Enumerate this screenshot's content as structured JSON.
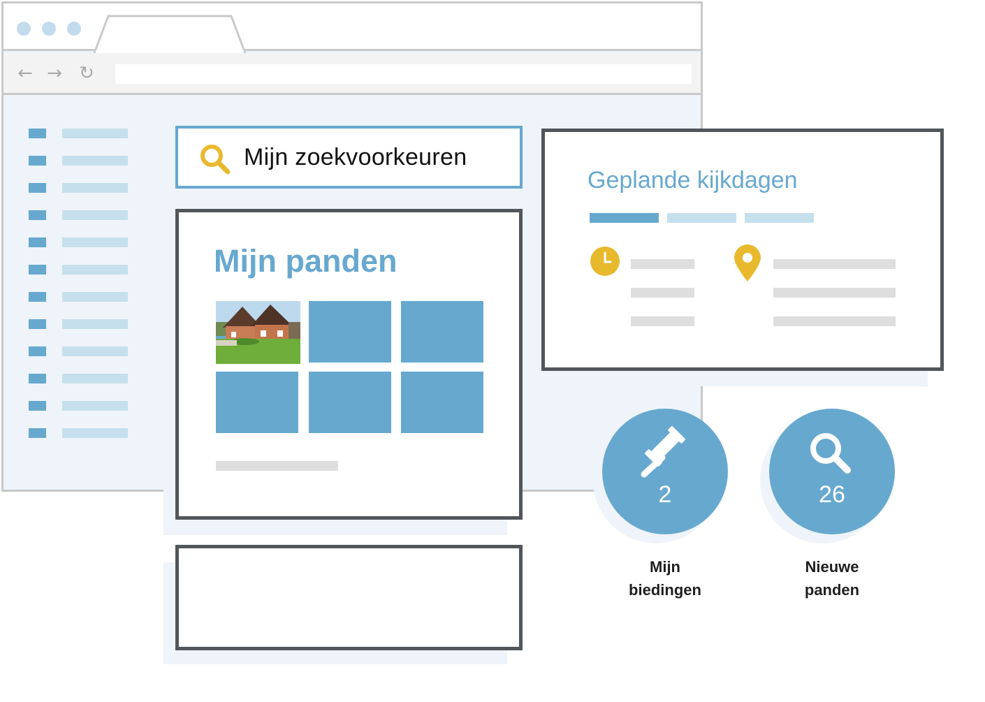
{
  "search": {
    "label": "Mijn zoekvoorkeuren",
    "icon": "search-icon"
  },
  "panden": {
    "title": "Mijn panden"
  },
  "kijkdagen": {
    "title": "Geplande kijkdagen",
    "icons": [
      "clock-icon",
      "location-pin-icon"
    ]
  },
  "stats": [
    {
      "value": "2",
      "label_line1": "Mijn",
      "label_line2": "biedingen",
      "icon": "gavel-icon"
    },
    {
      "value": "26",
      "label_line1": "Nieuwe",
      "label_line2": "panden",
      "icon": "search-icon"
    }
  ],
  "colors": {
    "accent": "#67a8cf",
    "accent_light": "#c6dfed",
    "yellow": "#e9b92d",
    "border_dark": "#50565a",
    "frame": "#c9c9c9"
  }
}
